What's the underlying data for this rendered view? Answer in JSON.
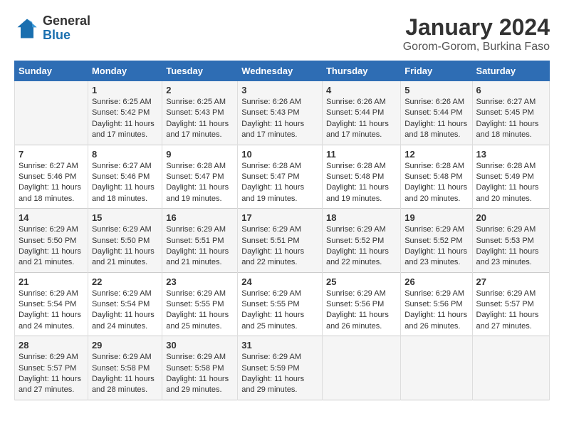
{
  "logo": {
    "general": "General",
    "blue": "Blue"
  },
  "title": "January 2024",
  "location": "Gorom-Gorom, Burkina Faso",
  "days_of_week": [
    "Sunday",
    "Monday",
    "Tuesday",
    "Wednesday",
    "Thursday",
    "Friday",
    "Saturday"
  ],
  "weeks": [
    [
      {
        "day": "",
        "info": ""
      },
      {
        "day": "1",
        "sunrise": "Sunrise: 6:25 AM",
        "sunset": "Sunset: 5:42 PM",
        "daylight": "Daylight: 11 hours and 17 minutes."
      },
      {
        "day": "2",
        "sunrise": "Sunrise: 6:25 AM",
        "sunset": "Sunset: 5:43 PM",
        "daylight": "Daylight: 11 hours and 17 minutes."
      },
      {
        "day": "3",
        "sunrise": "Sunrise: 6:26 AM",
        "sunset": "Sunset: 5:43 PM",
        "daylight": "Daylight: 11 hours and 17 minutes."
      },
      {
        "day": "4",
        "sunrise": "Sunrise: 6:26 AM",
        "sunset": "Sunset: 5:44 PM",
        "daylight": "Daylight: 11 hours and 17 minutes."
      },
      {
        "day": "5",
        "sunrise": "Sunrise: 6:26 AM",
        "sunset": "Sunset: 5:44 PM",
        "daylight": "Daylight: 11 hours and 18 minutes."
      },
      {
        "day": "6",
        "sunrise": "Sunrise: 6:27 AM",
        "sunset": "Sunset: 5:45 PM",
        "daylight": "Daylight: 11 hours and 18 minutes."
      }
    ],
    [
      {
        "day": "7",
        "sunrise": "Sunrise: 6:27 AM",
        "sunset": "Sunset: 5:46 PM",
        "daylight": "Daylight: 11 hours and 18 minutes."
      },
      {
        "day": "8",
        "sunrise": "Sunrise: 6:27 AM",
        "sunset": "Sunset: 5:46 PM",
        "daylight": "Daylight: 11 hours and 18 minutes."
      },
      {
        "day": "9",
        "sunrise": "Sunrise: 6:28 AM",
        "sunset": "Sunset: 5:47 PM",
        "daylight": "Daylight: 11 hours and 19 minutes."
      },
      {
        "day": "10",
        "sunrise": "Sunrise: 6:28 AM",
        "sunset": "Sunset: 5:47 PM",
        "daylight": "Daylight: 11 hours and 19 minutes."
      },
      {
        "day": "11",
        "sunrise": "Sunrise: 6:28 AM",
        "sunset": "Sunset: 5:48 PM",
        "daylight": "Daylight: 11 hours and 19 minutes."
      },
      {
        "day": "12",
        "sunrise": "Sunrise: 6:28 AM",
        "sunset": "Sunset: 5:48 PM",
        "daylight": "Daylight: 11 hours and 20 minutes."
      },
      {
        "day": "13",
        "sunrise": "Sunrise: 6:28 AM",
        "sunset": "Sunset: 5:49 PM",
        "daylight": "Daylight: 11 hours and 20 minutes."
      }
    ],
    [
      {
        "day": "14",
        "sunrise": "Sunrise: 6:29 AM",
        "sunset": "Sunset: 5:50 PM",
        "daylight": "Daylight: 11 hours and 21 minutes."
      },
      {
        "day": "15",
        "sunrise": "Sunrise: 6:29 AM",
        "sunset": "Sunset: 5:50 PM",
        "daylight": "Daylight: 11 hours and 21 minutes."
      },
      {
        "day": "16",
        "sunrise": "Sunrise: 6:29 AM",
        "sunset": "Sunset: 5:51 PM",
        "daylight": "Daylight: 11 hours and 21 minutes."
      },
      {
        "day": "17",
        "sunrise": "Sunrise: 6:29 AM",
        "sunset": "Sunset: 5:51 PM",
        "daylight": "Daylight: 11 hours and 22 minutes."
      },
      {
        "day": "18",
        "sunrise": "Sunrise: 6:29 AM",
        "sunset": "Sunset: 5:52 PM",
        "daylight": "Daylight: 11 hours and 22 minutes."
      },
      {
        "day": "19",
        "sunrise": "Sunrise: 6:29 AM",
        "sunset": "Sunset: 5:52 PM",
        "daylight": "Daylight: 11 hours and 23 minutes."
      },
      {
        "day": "20",
        "sunrise": "Sunrise: 6:29 AM",
        "sunset": "Sunset: 5:53 PM",
        "daylight": "Daylight: 11 hours and 23 minutes."
      }
    ],
    [
      {
        "day": "21",
        "sunrise": "Sunrise: 6:29 AM",
        "sunset": "Sunset: 5:54 PM",
        "daylight": "Daylight: 11 hours and 24 minutes."
      },
      {
        "day": "22",
        "sunrise": "Sunrise: 6:29 AM",
        "sunset": "Sunset: 5:54 PM",
        "daylight": "Daylight: 11 hours and 24 minutes."
      },
      {
        "day": "23",
        "sunrise": "Sunrise: 6:29 AM",
        "sunset": "Sunset: 5:55 PM",
        "daylight": "Daylight: 11 hours and 25 minutes."
      },
      {
        "day": "24",
        "sunrise": "Sunrise: 6:29 AM",
        "sunset": "Sunset: 5:55 PM",
        "daylight": "Daylight: 11 hours and 25 minutes."
      },
      {
        "day": "25",
        "sunrise": "Sunrise: 6:29 AM",
        "sunset": "Sunset: 5:56 PM",
        "daylight": "Daylight: 11 hours and 26 minutes."
      },
      {
        "day": "26",
        "sunrise": "Sunrise: 6:29 AM",
        "sunset": "Sunset: 5:56 PM",
        "daylight": "Daylight: 11 hours and 26 minutes."
      },
      {
        "day": "27",
        "sunrise": "Sunrise: 6:29 AM",
        "sunset": "Sunset: 5:57 PM",
        "daylight": "Daylight: 11 hours and 27 minutes."
      }
    ],
    [
      {
        "day": "28",
        "sunrise": "Sunrise: 6:29 AM",
        "sunset": "Sunset: 5:57 PM",
        "daylight": "Daylight: 11 hours and 27 minutes."
      },
      {
        "day": "29",
        "sunrise": "Sunrise: 6:29 AM",
        "sunset": "Sunset: 5:58 PM",
        "daylight": "Daylight: 11 hours and 28 minutes."
      },
      {
        "day": "30",
        "sunrise": "Sunrise: 6:29 AM",
        "sunset": "Sunset: 5:58 PM",
        "daylight": "Daylight: 11 hours and 29 minutes."
      },
      {
        "day": "31",
        "sunrise": "Sunrise: 6:29 AM",
        "sunset": "Sunset: 5:59 PM",
        "daylight": "Daylight: 11 hours and 29 minutes."
      },
      {
        "day": "",
        "info": ""
      },
      {
        "day": "",
        "info": ""
      },
      {
        "day": "",
        "info": ""
      }
    ]
  ]
}
